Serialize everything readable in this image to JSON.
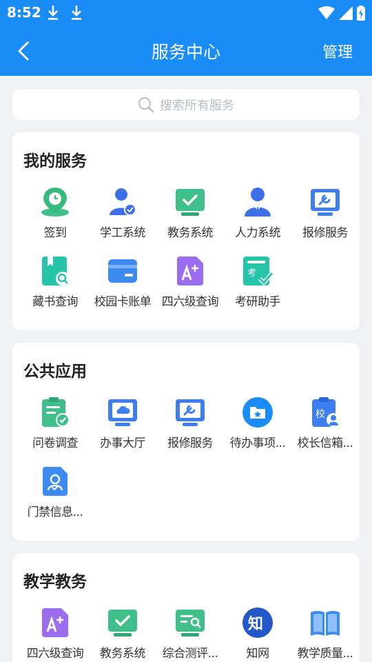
{
  "status_bar": {
    "time": "8:52"
  },
  "header": {
    "title": "服务中心",
    "manage": "管理"
  },
  "search": {
    "placeholder": "搜索所有服务"
  },
  "sections": [
    {
      "title": "我的服务",
      "items": [
        {
          "label": "签到",
          "icon": "checkin-location-icon"
        },
        {
          "label": "学工系统",
          "icon": "student-affairs-icon"
        },
        {
          "label": "教务系统",
          "icon": "academic-affairs-icon"
        },
        {
          "label": "人力系统",
          "icon": "hr-system-icon"
        },
        {
          "label": "报修服务",
          "icon": "repair-service-icon"
        },
        {
          "label": "藏书查询",
          "icon": "book-search-icon"
        },
        {
          "label": "校园卡账单",
          "icon": "campus-card-icon"
        },
        {
          "label": "四六级查询",
          "icon": "cet-query-icon"
        },
        {
          "label": "考研助手",
          "icon": "exam-helper-icon"
        }
      ]
    },
    {
      "title": "公共应用",
      "items": [
        {
          "label": "问卷调查",
          "icon": "survey-icon"
        },
        {
          "label": "办事大厅",
          "icon": "service-hall-icon"
        },
        {
          "label": "报修服务",
          "icon": "repair-service-icon"
        },
        {
          "label": "待办事项...",
          "icon": "todo-folder-icon"
        },
        {
          "label": "校长信箱...",
          "icon": "principal-mailbox-icon"
        },
        {
          "label": "门禁信息...",
          "icon": "access-control-icon"
        }
      ]
    },
    {
      "title": "教学教务",
      "items": [
        {
          "label": "四六级查询",
          "icon": "cet-query-icon"
        },
        {
          "label": "教务系统",
          "icon": "academic-affairs-icon"
        },
        {
          "label": "综合测评...",
          "icon": "evaluation-icon"
        },
        {
          "label": "知网",
          "icon": "cnki-icon"
        },
        {
          "label": "教学质量...",
          "icon": "teaching-quality-icon"
        }
      ]
    }
  ]
}
